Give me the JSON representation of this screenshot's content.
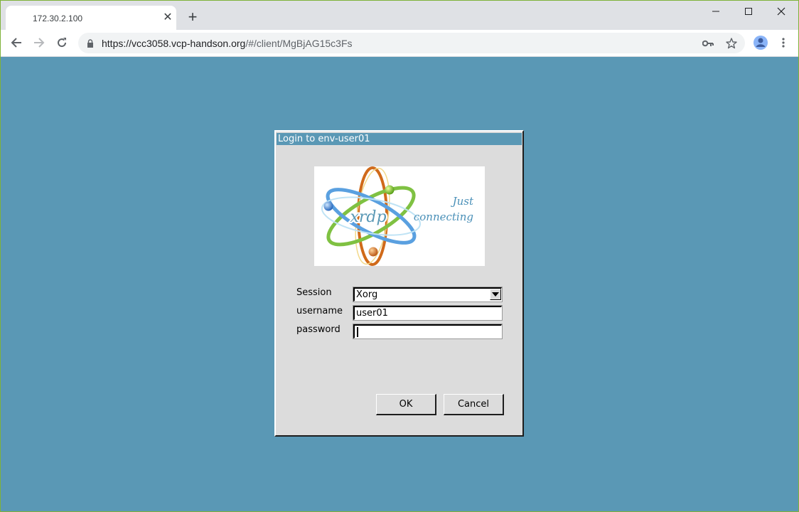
{
  "browser": {
    "tab_title": "172.30.2.100",
    "url_main": "https://vcc3058.vcp-handson.org",
    "url_rest": "/#/client/MgBjAG15c3Fs"
  },
  "dialog": {
    "title": "Login to env-user01",
    "logo": {
      "brand": "xrdp",
      "tagline_line1": "Just",
      "tagline_line2": "connecting"
    },
    "session_label": "Session",
    "session_value": "Xorg",
    "username_label": "username",
    "username_value": "user01",
    "password_label": "password",
    "password_value": "",
    "ok_label": "OK",
    "cancel_label": "Cancel"
  },
  "colors": {
    "desktop": "#5a98b5",
    "dialog_bg": "#dcdcdc",
    "title_bar": "#5a98b5"
  }
}
